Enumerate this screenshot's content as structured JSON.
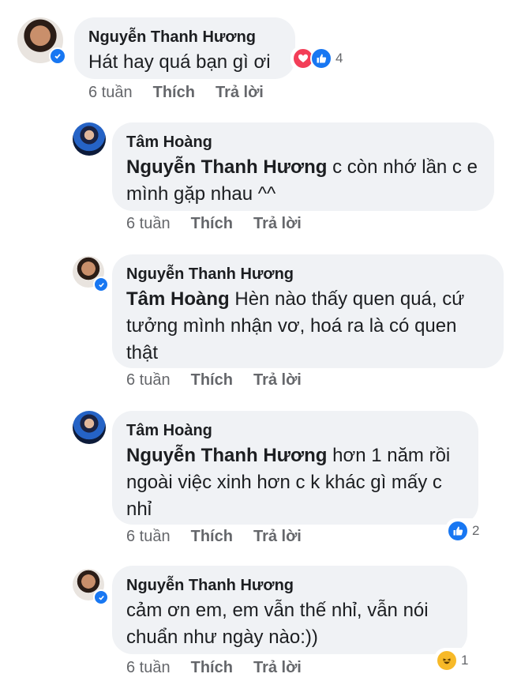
{
  "comments": [
    {
      "author": "Nguyễn Thanh Hương",
      "mention": "",
      "text": "Hát hay quá bạn gì ơi",
      "time": "6 tuần",
      "like_label": "Thích",
      "reply_label": "Trả lời",
      "reactions": [
        "love-icon",
        "like-icon"
      ],
      "reaction_count": "4"
    },
    {
      "author": "Tâm Hoàng",
      "mention": "Nguyễn Thanh Hương",
      "text": " c còn nhớ lần c e mình gặp nhau ^^",
      "time": "6 tuần",
      "like_label": "Thích",
      "reply_label": "Trả lời"
    },
    {
      "author": "Nguyễn Thanh Hương",
      "mention": "Tâm Hoàng",
      "text": "  Hèn nào thấy quen quá, cứ tưởng mình nhận vơ, hoá ra là có quen thật",
      "time": "6 tuần",
      "like_label": "Thích",
      "reply_label": "Trả lời"
    },
    {
      "author": "Tâm Hoàng",
      "mention": "Nguyễn Thanh Hương",
      "text": " hơn 1 năm rồi ngoài việc xinh hơn c k khác gì mấy c nhỉ",
      "time": "6 tuần",
      "like_label": "Thích",
      "reply_label": "Trả lời",
      "reactions": [
        "like-icon"
      ],
      "reaction_count": "2"
    },
    {
      "author": "Nguyễn Thanh Hương",
      "mention": "",
      "text": " cảm ơn em, em vẫn thế nhỉ, vẫn nói chuẩn như ngày nào:))",
      "time": "6 tuần",
      "like_label": "Thích",
      "reply_label": "Trả lời",
      "reactions": [
        "haha-icon"
      ],
      "reaction_count": "1"
    }
  ],
  "colors": {
    "bubble": "#f0f2f5",
    "meta": "#65676b",
    "verified": "#1877f2",
    "like": "#1877f2",
    "love": "#f33e58",
    "haha": "#f7b928"
  }
}
